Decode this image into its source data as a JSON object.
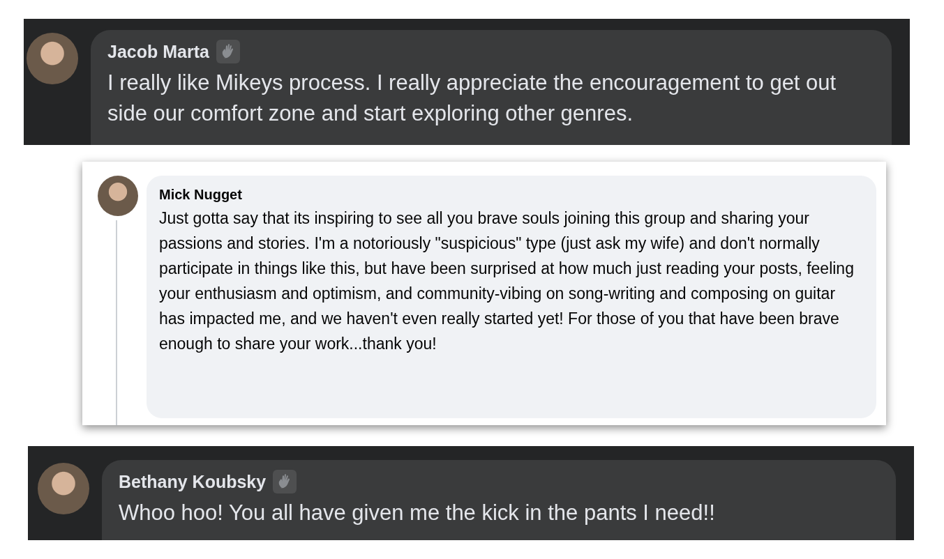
{
  "comments": [
    {
      "kind": "dark",
      "name": "Jacob Marta",
      "wave_badge": true,
      "text": "I really like Mikeys process. I really appreciate the encouragement to get out side our comfort zone and start exploring other genres."
    },
    {
      "kind": "light",
      "name": "Mick Nugget",
      "wave_badge": false,
      "text": "Just gotta say that its inspiring to see all you brave souls joining this group and sharing your passions and stories. I'm a notoriously \"suspicious\" type (just ask my wife) and don't normally participate in things like this, but have been surprised at how much just reading your posts, feeling your enthusiasm and optimism, and community-vibing on song-writing and composing on guitar has impacted me, and we haven't even really started yet! For those of you that have been brave enough to share your work...thank you!"
    },
    {
      "kind": "dark",
      "name": "Bethany Koubsky",
      "wave_badge": true,
      "text": "Whoo hoo! You all have given me the kick in the pants I need!!"
    }
  ]
}
